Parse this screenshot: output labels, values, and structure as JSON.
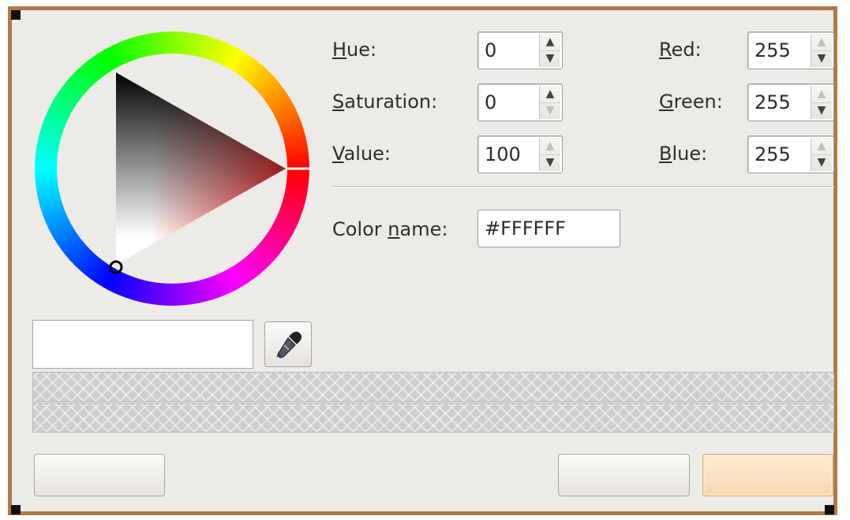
{
  "colors": {
    "frame": "#b07a45",
    "background": "#edebe7",
    "default_button": "#f9e1c1",
    "current_color": "#FFFFFF"
  },
  "hsv": {
    "hue": {
      "label_underline": "H",
      "label_rest": "ue:",
      "value": "0",
      "down_enabled": true
    },
    "saturation": {
      "label_underline": "S",
      "label_rest": "aturation:",
      "value": "0",
      "down_enabled": false
    },
    "value": {
      "label_underline": "V",
      "label_rest": "alue:",
      "value": "100",
      "up_enabled": false
    }
  },
  "rgb": {
    "red": {
      "label_underline": "R",
      "label_rest": "ed:",
      "value": "255",
      "up_enabled": false
    },
    "green": {
      "label_underline": "G",
      "label_rest": "reen:",
      "value": "255",
      "up_enabled": false
    },
    "blue": {
      "label_underline": "B",
      "label_rest": "lue:",
      "value": "255",
      "up_enabled": false
    }
  },
  "color_name": {
    "label_prefix": "Color ",
    "label_underline": "n",
    "label_rest": "ame:",
    "value": "#FFFFFF"
  },
  "icons": {
    "eyedropper": "eyedropper-icon",
    "spin_up": "▲",
    "spin_down": "▼"
  },
  "buttons": {
    "help_label": "",
    "cancel_label": "",
    "ok_label": ""
  }
}
